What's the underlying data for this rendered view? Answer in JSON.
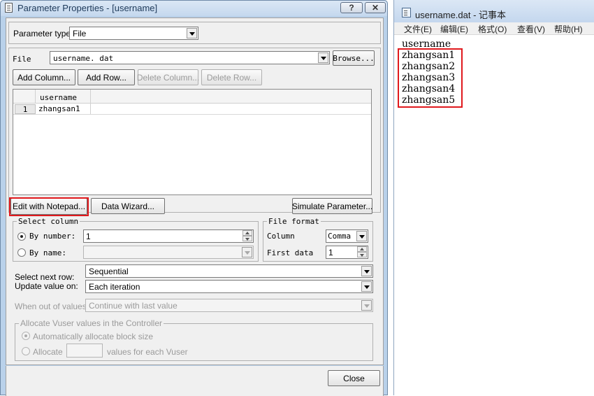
{
  "dialog": {
    "title": "Parameter Properties - [username]",
    "help_glyph": "?",
    "close_glyph": "✕",
    "param_type_label": "Parameter type:",
    "param_type_value": "File",
    "file_label": "File",
    "file_value": "username. dat",
    "browse_label": "Browse...",
    "add_column_label": "Add Column...",
    "add_row_label": "Add Row...",
    "delete_column_label": "Delete Column...",
    "delete_row_label": "Delete Row...",
    "grid": {
      "column_header": "username",
      "rows": [
        {
          "index": "1",
          "value": "zhangsan1"
        }
      ]
    },
    "edit_notepad_label": "Edit with Notepad...",
    "data_wizard_label": "Data Wizard...",
    "simulate_label": "Simulate Parameter...",
    "select_column": {
      "title": "Select column",
      "by_number_label": "By number:",
      "by_number_value": "1",
      "by_name_label": "By name:"
    },
    "file_format": {
      "title": "File format",
      "column_label": "Column",
      "column_value": "Comma",
      "first_data_label": "First data",
      "first_data_value": "1"
    },
    "select_next_row_label": "Select next row:",
    "select_next_row_value": "Sequential",
    "update_value_label": "Update value on:",
    "update_value_value": "Each iteration",
    "out_of_values_label": "When out of values:",
    "out_of_values_value": "Continue with last value",
    "allocate": {
      "title": "Allocate Vuser values in the Controller",
      "auto_label": "Automatically allocate block size",
      "allocate_label": "Allocate",
      "allocate_suffix": "values for each Vuser"
    },
    "close_label": "Close"
  },
  "notepad": {
    "title": "username.dat - 记事本",
    "menu": [
      "文件(E)",
      "编辑(E)",
      "格式(O)",
      "查看(V)",
      "帮助(H)"
    ],
    "lines": [
      "username",
      "zhangsan1",
      "zhangsan2",
      "zhangsan3",
      "zhangsan4",
      "zhangsan5"
    ]
  },
  "colors": {
    "highlight": "#e0191d",
    "window_frame": "#b9d1ea",
    "dialog_face": "#f0f0f0"
  }
}
